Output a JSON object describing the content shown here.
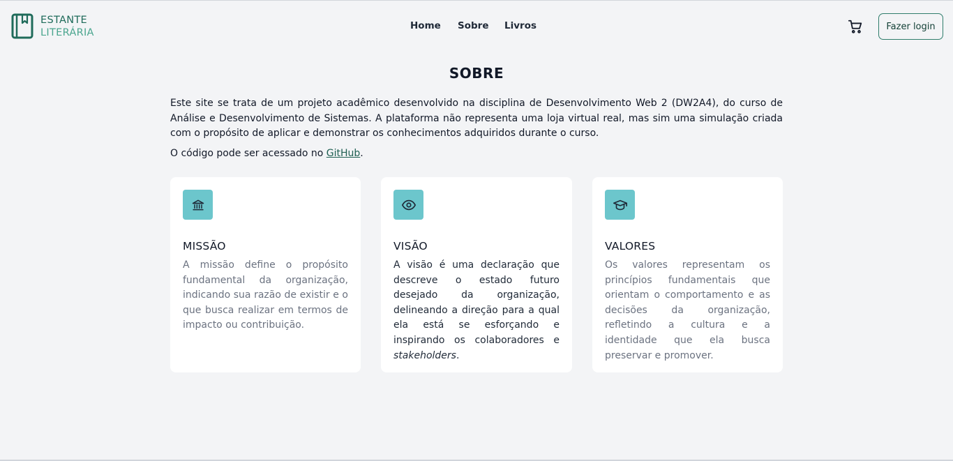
{
  "header": {
    "logo_line1": "ESTANTE",
    "logo_line2": "LITERÁRIA",
    "nav": [
      "Home",
      "Sobre",
      "Livros"
    ],
    "login_label": "Fazer login",
    "cart_icon": "cart-icon"
  },
  "page": {
    "title": "SOBRE",
    "intro": "Este site se trata de um projeto acadêmico desenvolvido na disciplina de Desenvolvimento Web 2 (DW2A4), do curso de Análise e Desenvolvimento de Sistemas. A plataforma não representa uma loja virtual real, mas sim uma simulação criada com o propósito de aplicar e demonstrar os conhecimentos adquiridos durante o curso.",
    "code_prefix": "O código pode ser acessado no ",
    "code_link": "GitHub",
    "code_suffix": "."
  },
  "cards": [
    {
      "icon": "institution-icon",
      "title": "MISSÃO",
      "text": "A missão define o propósito fundamental da organização, indicando sua razão de existir e o que busca realizar em termos de impacto ou contribuição."
    },
    {
      "icon": "eye-icon",
      "title": "VISÃO",
      "text": "A visão é uma declaração que descreve o estado futuro desejado da organização, delineando a direção para a qual ela está se esforçando e inspirando os colaboradores e",
      "text_em": "stakeholders",
      "text_end": "."
    },
    {
      "icon": "graduation-cap-icon",
      "title": "VALORES",
      "text": "Os valores representam os princípios fundamentais que orientam o comportamento e as decisões da organização, refletindo a cultura e a identidade que ela busca preservar e promover."
    }
  ],
  "colors": {
    "brand": "#1f6b5a",
    "card_icon_bg": "#6cc6cc",
    "background": "#f3f4f6"
  }
}
